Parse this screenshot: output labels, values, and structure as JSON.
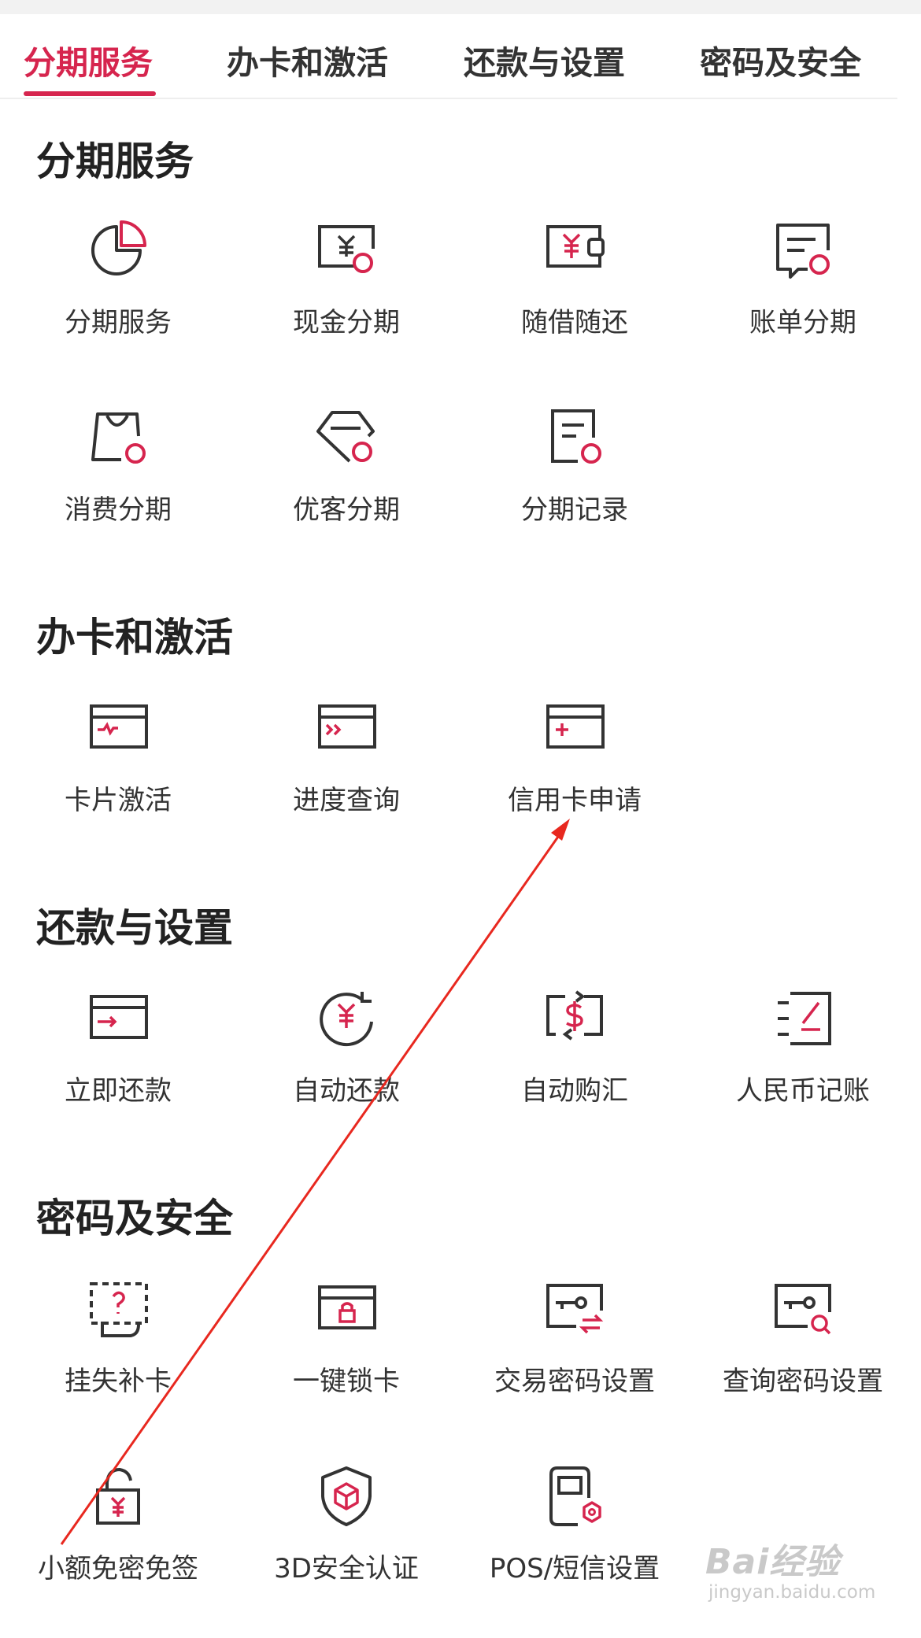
{
  "tabs": [
    {
      "label": "分期服务",
      "active": true
    },
    {
      "label": "办卡和激活",
      "active": false
    },
    {
      "label": "还款与设置",
      "active": false
    },
    {
      "label": "密码及安全",
      "active": false
    }
  ],
  "sections": [
    {
      "title": "分期服务",
      "items": [
        {
          "label": "分期服务",
          "icon": "pie-chart-icon"
        },
        {
          "label": "现金分期",
          "icon": "cash-installment-icon"
        },
        {
          "label": "随借随还",
          "icon": "wallet-icon"
        },
        {
          "label": "账单分期",
          "icon": "bill-installment-icon"
        },
        {
          "label": "消费分期",
          "icon": "shopping-bag-icon"
        },
        {
          "label": "优客分期",
          "icon": "diamond-icon"
        },
        {
          "label": "分期记录",
          "icon": "record-icon"
        }
      ]
    },
    {
      "title": "办卡和激活",
      "items": [
        {
          "label": "卡片激活",
          "icon": "card-activate-icon"
        },
        {
          "label": "进度查询",
          "icon": "card-progress-icon"
        },
        {
          "label": "信用卡申请",
          "icon": "card-apply-icon"
        }
      ]
    },
    {
      "title": "还款与设置",
      "items": [
        {
          "label": "立即还款",
          "icon": "card-repay-icon"
        },
        {
          "label": "自动还款",
          "icon": "auto-repay-icon"
        },
        {
          "label": "自动购汇",
          "icon": "auto-exchange-icon"
        },
        {
          "label": "人民币记账",
          "icon": "rmb-bookkeeping-icon"
        }
      ]
    },
    {
      "title": "密码及安全",
      "items": [
        {
          "label": "挂失补卡",
          "icon": "report-loss-icon"
        },
        {
          "label": "一键锁卡",
          "icon": "lock-card-icon"
        },
        {
          "label": "交易密码设置",
          "icon": "trade-password-icon"
        },
        {
          "label": "查询密码设置",
          "icon": "query-password-icon"
        },
        {
          "label": "小额免密免签",
          "icon": "small-amount-unlock-icon"
        },
        {
          "label": "3D安全认证",
          "icon": "shield-3d-icon"
        },
        {
          "label": "POS/短信设置",
          "icon": "pos-sms-icon"
        }
      ]
    }
  ],
  "watermark": {
    "logo": "Bai经验",
    "url": "jingyan.baidu.com"
  },
  "colors": {
    "accent": "#d6254e",
    "icon_stroke": "#333333",
    "annotation_arrow": "#e8281f"
  }
}
